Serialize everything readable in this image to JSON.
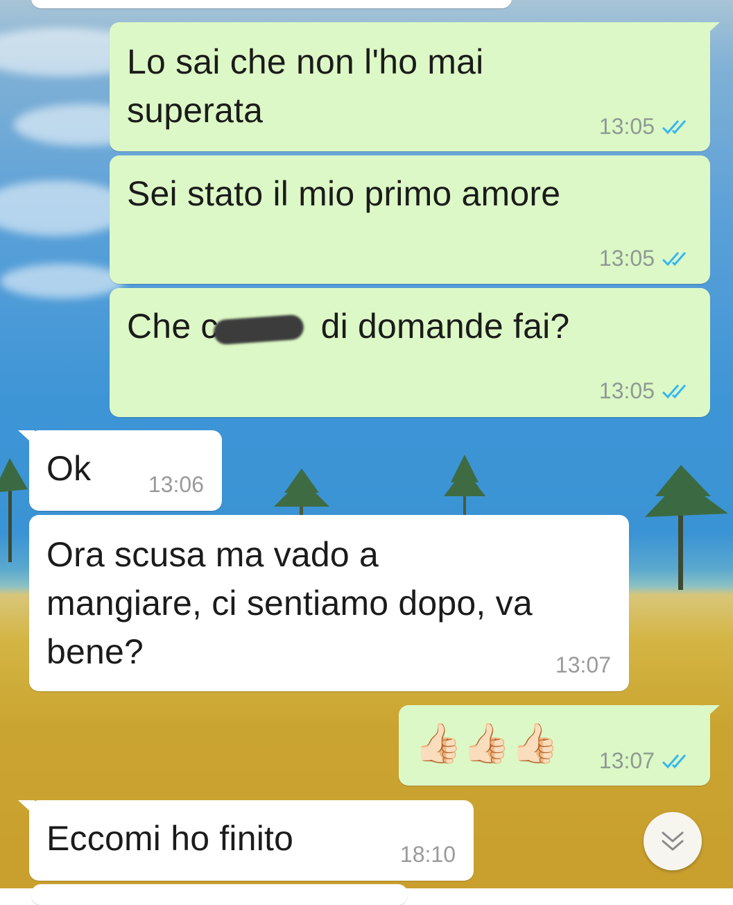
{
  "messages": [
    {
      "direction": "outgoing",
      "lines": [
        "Lo sai che non l'ho mai",
        "superata"
      ],
      "time": "13:05",
      "status": "read"
    },
    {
      "direction": "outgoing",
      "lines": [
        "Sei stato il mio primo amore"
      ],
      "time": "13:05",
      "status": "read"
    },
    {
      "direction": "outgoing",
      "text_before": "Che c",
      "text_after": "di domande fai?",
      "redacted": true,
      "time": "13:05",
      "status": "read"
    },
    {
      "direction": "incoming",
      "lines": [
        "Ok"
      ],
      "time": "13:06"
    },
    {
      "direction": "incoming",
      "lines": [
        "Ora scusa ma vado a",
        "mangiare, ci sentiamo dopo, va",
        "bene?"
      ],
      "time": "13:07"
    },
    {
      "direction": "outgoing",
      "emoji": "👍🏻👍🏻👍🏻",
      "time": "13:07",
      "status": "read"
    },
    {
      "direction": "incoming",
      "lines": [
        "Eccomi ho finito"
      ],
      "time": "18:10"
    }
  ],
  "colors": {
    "outgoing_bubble": "#dcf8c6",
    "incoming_bubble": "#ffffff",
    "read_ticks": "#34b7f1",
    "timestamp": "#8e9a93"
  },
  "icons": {
    "read_status": "double-check-icon",
    "scroll_down": "double-chevron-down-icon"
  }
}
